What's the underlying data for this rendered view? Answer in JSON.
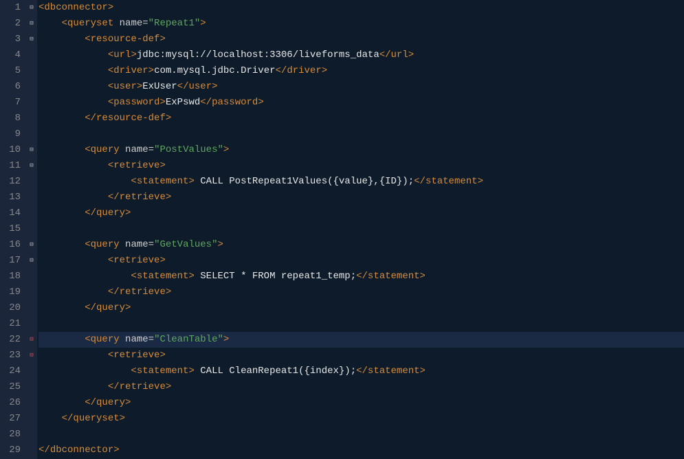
{
  "lines": [
    {
      "num": 1,
      "fold": "minus",
      "hl": false,
      "segments": [
        {
          "cls": "bracket",
          "t": "<"
        },
        {
          "cls": "tag",
          "t": "dbconnector"
        },
        {
          "cls": "bracket",
          "t": ">"
        }
      ]
    },
    {
      "num": 2,
      "fold": "minus",
      "hl": false,
      "indent": "    ",
      "segments": [
        {
          "cls": "bracket",
          "t": "<"
        },
        {
          "cls": "tag",
          "t": "queryset"
        },
        {
          "cls": "text",
          "t": " "
        },
        {
          "cls": "attr",
          "t": "name"
        },
        {
          "cls": "equals",
          "t": "="
        },
        {
          "cls": "val",
          "t": "\"Repeat1\""
        },
        {
          "cls": "bracket",
          "t": ">"
        }
      ]
    },
    {
      "num": 3,
      "fold": "minus",
      "hl": false,
      "indent": "        ",
      "segments": [
        {
          "cls": "bracket",
          "t": "<"
        },
        {
          "cls": "tag",
          "t": "resource-def"
        },
        {
          "cls": "bracket",
          "t": ">"
        }
      ]
    },
    {
      "num": 4,
      "fold": "",
      "hl": false,
      "indent": "            ",
      "segments": [
        {
          "cls": "bracket",
          "t": "<"
        },
        {
          "cls": "tag",
          "t": "url"
        },
        {
          "cls": "bracket",
          "t": ">"
        },
        {
          "cls": "text",
          "t": "jdbc:mysql://localhost:3306/liveforms_data"
        },
        {
          "cls": "bracket",
          "t": "</"
        },
        {
          "cls": "tag",
          "t": "url"
        },
        {
          "cls": "bracket",
          "t": ">"
        }
      ]
    },
    {
      "num": 5,
      "fold": "",
      "hl": false,
      "indent": "            ",
      "segments": [
        {
          "cls": "bracket",
          "t": "<"
        },
        {
          "cls": "tag",
          "t": "driver"
        },
        {
          "cls": "bracket",
          "t": ">"
        },
        {
          "cls": "text",
          "t": "com.mysql.jdbc.Driver"
        },
        {
          "cls": "bracket",
          "t": "</"
        },
        {
          "cls": "tag",
          "t": "driver"
        },
        {
          "cls": "bracket",
          "t": ">"
        }
      ]
    },
    {
      "num": 6,
      "fold": "",
      "hl": false,
      "indent": "            ",
      "segments": [
        {
          "cls": "bracket",
          "t": "<"
        },
        {
          "cls": "tag",
          "t": "user"
        },
        {
          "cls": "bracket",
          "t": ">"
        },
        {
          "cls": "text",
          "t": "ExUser"
        },
        {
          "cls": "bracket",
          "t": "</"
        },
        {
          "cls": "tag",
          "t": "user"
        },
        {
          "cls": "bracket",
          "t": ">"
        }
      ]
    },
    {
      "num": 7,
      "fold": "",
      "hl": false,
      "indent": "            ",
      "segments": [
        {
          "cls": "bracket",
          "t": "<"
        },
        {
          "cls": "tag",
          "t": "password"
        },
        {
          "cls": "bracket",
          "t": ">"
        },
        {
          "cls": "text",
          "t": "ExPswd"
        },
        {
          "cls": "bracket",
          "t": "</"
        },
        {
          "cls": "tag",
          "t": "password"
        },
        {
          "cls": "bracket",
          "t": ">"
        }
      ]
    },
    {
      "num": 8,
      "fold": "",
      "hl": false,
      "indent": "        ",
      "segments": [
        {
          "cls": "bracket",
          "t": "</"
        },
        {
          "cls": "tag",
          "t": "resource-def"
        },
        {
          "cls": "bracket",
          "t": ">"
        }
      ]
    },
    {
      "num": 9,
      "fold": "",
      "hl": false,
      "indent": "",
      "segments": []
    },
    {
      "num": 10,
      "fold": "minus",
      "hl": false,
      "indent": "        ",
      "segments": [
        {
          "cls": "bracket",
          "t": "<"
        },
        {
          "cls": "tag",
          "t": "query"
        },
        {
          "cls": "text",
          "t": " "
        },
        {
          "cls": "attr",
          "t": "name"
        },
        {
          "cls": "equals",
          "t": "="
        },
        {
          "cls": "val",
          "t": "\"PostValues\""
        },
        {
          "cls": "bracket",
          "t": ">"
        }
      ]
    },
    {
      "num": 11,
      "fold": "minus",
      "hl": false,
      "indent": "            ",
      "segments": [
        {
          "cls": "bracket",
          "t": "<"
        },
        {
          "cls": "tag",
          "t": "retrieve"
        },
        {
          "cls": "bracket",
          "t": ">"
        }
      ]
    },
    {
      "num": 12,
      "fold": "",
      "hl": false,
      "indent": "                ",
      "segments": [
        {
          "cls": "bracket",
          "t": "<"
        },
        {
          "cls": "tag",
          "t": "statement"
        },
        {
          "cls": "bracket",
          "t": ">"
        },
        {
          "cls": "text",
          "t": " CALL PostRepeat1Values({value},{ID});"
        },
        {
          "cls": "bracket",
          "t": "</"
        },
        {
          "cls": "tag",
          "t": "statement"
        },
        {
          "cls": "bracket",
          "t": ">"
        }
      ]
    },
    {
      "num": 13,
      "fold": "",
      "hl": false,
      "indent": "            ",
      "segments": [
        {
          "cls": "bracket",
          "t": "</"
        },
        {
          "cls": "tag",
          "t": "retrieve"
        },
        {
          "cls": "bracket",
          "t": ">"
        }
      ]
    },
    {
      "num": 14,
      "fold": "",
      "hl": false,
      "indent": "        ",
      "segments": [
        {
          "cls": "bracket",
          "t": "</"
        },
        {
          "cls": "tag",
          "t": "query"
        },
        {
          "cls": "bracket",
          "t": ">"
        }
      ]
    },
    {
      "num": 15,
      "fold": "",
      "hl": false,
      "indent": "",
      "segments": []
    },
    {
      "num": 16,
      "fold": "minus",
      "hl": false,
      "indent": "        ",
      "segments": [
        {
          "cls": "bracket",
          "t": "<"
        },
        {
          "cls": "tag",
          "t": "query"
        },
        {
          "cls": "text",
          "t": " "
        },
        {
          "cls": "attr",
          "t": "name"
        },
        {
          "cls": "equals",
          "t": "="
        },
        {
          "cls": "val",
          "t": "\"GetValues\""
        },
        {
          "cls": "bracket",
          "t": ">"
        }
      ]
    },
    {
      "num": 17,
      "fold": "minus",
      "hl": false,
      "indent": "            ",
      "segments": [
        {
          "cls": "bracket",
          "t": "<"
        },
        {
          "cls": "tag",
          "t": "retrieve"
        },
        {
          "cls": "bracket",
          "t": ">"
        }
      ]
    },
    {
      "num": 18,
      "fold": "",
      "hl": false,
      "indent": "                ",
      "segments": [
        {
          "cls": "bracket",
          "t": "<"
        },
        {
          "cls": "tag",
          "t": "statement"
        },
        {
          "cls": "bracket",
          "t": ">"
        },
        {
          "cls": "text",
          "t": " SELECT * FROM repeat1_temp;"
        },
        {
          "cls": "bracket",
          "t": "</"
        },
        {
          "cls": "tag",
          "t": "statement"
        },
        {
          "cls": "bracket",
          "t": ">"
        }
      ]
    },
    {
      "num": 19,
      "fold": "",
      "hl": false,
      "indent": "            ",
      "segments": [
        {
          "cls": "bracket",
          "t": "</"
        },
        {
          "cls": "tag",
          "t": "retrieve"
        },
        {
          "cls": "bracket",
          "t": ">"
        }
      ]
    },
    {
      "num": 20,
      "fold": "",
      "hl": false,
      "indent": "        ",
      "segments": [
        {
          "cls": "bracket",
          "t": "</"
        },
        {
          "cls": "tag",
          "t": "query"
        },
        {
          "cls": "bracket",
          "t": ">"
        }
      ]
    },
    {
      "num": 21,
      "fold": "",
      "hl": false,
      "indent": "",
      "segments": []
    },
    {
      "num": 22,
      "fold": "red",
      "hl": true,
      "indent": "        ",
      "segments": [
        {
          "cls": "bracket",
          "t": "<"
        },
        {
          "cls": "tag",
          "t": "query"
        },
        {
          "cls": "text",
          "t": " "
        },
        {
          "cls": "attr",
          "t": "name"
        },
        {
          "cls": "equals",
          "t": "="
        },
        {
          "cls": "val",
          "t": "\"CleanTable\""
        },
        {
          "cls": "bracket",
          "t": ">"
        }
      ]
    },
    {
      "num": 23,
      "fold": "red",
      "hl": false,
      "indent": "            ",
      "segments": [
        {
          "cls": "bracket",
          "t": "<"
        },
        {
          "cls": "tag",
          "t": "retrieve"
        },
        {
          "cls": "bracket",
          "t": ">"
        }
      ]
    },
    {
      "num": 24,
      "fold": "",
      "hl": false,
      "indent": "                ",
      "segments": [
        {
          "cls": "bracket",
          "t": "<"
        },
        {
          "cls": "tag",
          "t": "statement"
        },
        {
          "cls": "bracket",
          "t": ">"
        },
        {
          "cls": "text",
          "t": " CALL CleanRepeat1({index});"
        },
        {
          "cls": "bracket",
          "t": "</"
        },
        {
          "cls": "tag",
          "t": "statement"
        },
        {
          "cls": "bracket",
          "t": ">"
        }
      ]
    },
    {
      "num": 25,
      "fold": "",
      "hl": false,
      "indent": "            ",
      "segments": [
        {
          "cls": "bracket",
          "t": "</"
        },
        {
          "cls": "tag",
          "t": "retrieve"
        },
        {
          "cls": "bracket",
          "t": ">"
        }
      ]
    },
    {
      "num": 26,
      "fold": "",
      "hl": false,
      "indent": "        ",
      "segments": [
        {
          "cls": "bracket",
          "t": "</"
        },
        {
          "cls": "tag",
          "t": "query"
        },
        {
          "cls": "bracket",
          "t": ">"
        }
      ]
    },
    {
      "num": 27,
      "fold": "",
      "hl": false,
      "indent": "    ",
      "segments": [
        {
          "cls": "bracket",
          "t": "</"
        },
        {
          "cls": "tag",
          "t": "queryset"
        },
        {
          "cls": "bracket",
          "t": ">"
        }
      ]
    },
    {
      "num": 28,
      "fold": "",
      "hl": false,
      "indent": "",
      "segments": []
    },
    {
      "num": 29,
      "fold": "",
      "hl": false,
      "indent": "",
      "segments": [
        {
          "cls": "bracket",
          "t": "</"
        },
        {
          "cls": "tag",
          "t": "dbconnector"
        },
        {
          "cls": "bracket",
          "t": ">"
        }
      ]
    }
  ],
  "fold_glyphs": {
    "minus": "⊟",
    "red": "⊟"
  }
}
